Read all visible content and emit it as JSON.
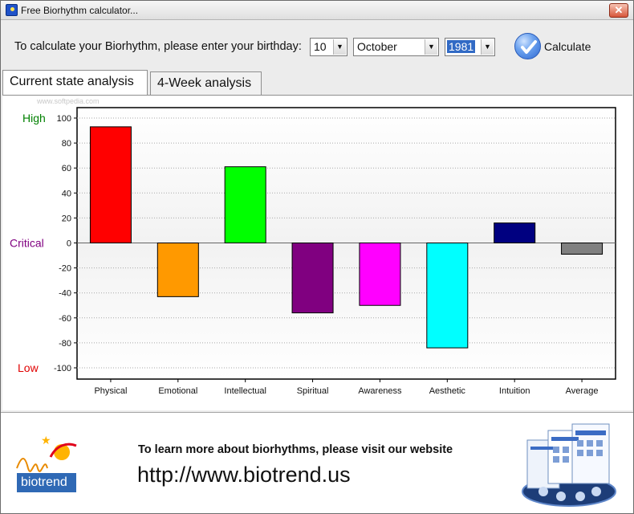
{
  "window": {
    "title": "Free Biorhythm calculator..."
  },
  "form": {
    "prompt": "To calculate your Biorhythm, please enter your birthday:",
    "day": "10",
    "month": "October",
    "year": "1981",
    "calculate_label": "Calculate"
  },
  "tabs": [
    "Current state analysis",
    "4-Week analysis"
  ],
  "chart_labels": {
    "high": "High",
    "critical": "Critical",
    "low": "Low",
    "watermark": "www.softpedia.com"
  },
  "chart_data": {
    "type": "bar",
    "categories": [
      "Physical",
      "Emotional",
      "Intellectual",
      "Spiritual",
      "Awareness",
      "Aesthetic",
      "Intuition",
      "Average"
    ],
    "values": [
      93,
      -43,
      61,
      -56,
      -50,
      -84,
      16,
      -9
    ],
    "colors": [
      "#ff0000",
      "#ff9900",
      "#00ff00",
      "#800080",
      "#ff00ff",
      "#00ffff",
      "#000080",
      "#808080"
    ],
    "ylim": [
      -100,
      100
    ],
    "yticks": [
      100,
      80,
      60,
      40,
      20,
      0,
      -20,
      -40,
      -60,
      -80,
      -100
    ],
    "grid": true
  },
  "footer": {
    "text": "To learn more about biorhythms, please visit our website",
    "url": "http://www.biotrend.us",
    "logo_text": "biotrend"
  }
}
